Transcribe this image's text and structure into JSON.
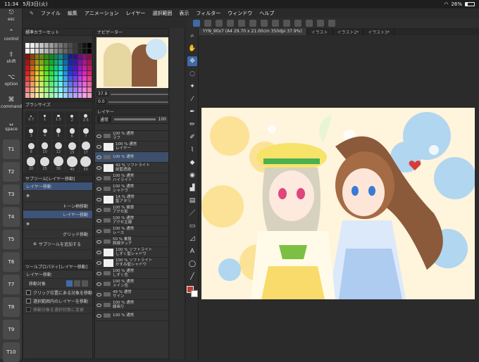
{
  "status_bar": {
    "time": "11:34",
    "date": "5月3日(火)",
    "battery_text": "26%",
    "battery_level": 0.26
  },
  "menubar": [
    "ファイル",
    "編集",
    "アニメーション",
    "レイヤー",
    "選択範囲",
    "表示",
    "フィルター",
    "ウィンドウ",
    "ヘルプ"
  ],
  "left_modifiers": [
    {
      "label": "esc",
      "icon": "esc-icon"
    },
    {
      "label": "control",
      "icon": "control-icon"
    },
    {
      "label": "shift",
      "icon": "shift-icon"
    },
    {
      "label": "option",
      "icon": "option-icon"
    },
    {
      "label": "command",
      "icon": "command-icon"
    },
    {
      "label": "space",
      "icon": "space-icon"
    }
  ],
  "t_keys": [
    "T1",
    "T2",
    "T3",
    "T4",
    "T5",
    "T6",
    "T7",
    "T8",
    "T9",
    "T10"
  ],
  "color_set": {
    "label": "標準カラーセット"
  },
  "brush_size": {
    "title": "ブラシサイズ",
    "values": [
      "0.7",
      "1",
      "1.5",
      "2",
      "2.5",
      "3",
      "4",
      "5",
      "6",
      "7",
      "8",
      "10",
      "12",
      "15",
      "17",
      "20",
      "25",
      "30",
      "40",
      "50"
    ]
  },
  "sub_tool": {
    "title": "サブツール[レイヤー移動]",
    "items": [
      {
        "label": "レイヤー移動",
        "selected": true
      },
      {
        "label": "トーン柄移動",
        "selected": false
      },
      {
        "label": "レイヤー移動",
        "selected": true
      },
      {
        "label": "グリッド移動",
        "selected": false
      }
    ],
    "add_label": "サブツールを追加する"
  },
  "tool_property": {
    "title": "ツールプロパティ[レイヤー移動]",
    "subtitle": "レイヤー移動",
    "target_label": "移動対象",
    "options": [
      {
        "label": "クリック位置にある対象を移動",
        "checked": false
      },
      {
        "label": "選択範囲内のレイヤーを移動",
        "checked": false
      },
      {
        "label": "移動対象を選択状態に変更",
        "checked": false
      }
    ]
  },
  "navigator": {
    "title": "ナビゲーター",
    "zoom": "37.9",
    "angle": "0.0"
  },
  "layer_panel": {
    "title": "レイヤー",
    "blend_mode": "通常",
    "opacity": "100",
    "layers": [
      {
        "opacity": "100 %",
        "mode": "通常",
        "name": "ラフ",
        "type": "folder"
      },
      {
        "opacity": "100 %",
        "mode": "通常",
        "name": "レイヤー",
        "type": "layer"
      },
      {
        "opacity": "100 %",
        "mode": "通常",
        "name": "",
        "type": "folder",
        "selected": true
      },
      {
        "opacity": "42 %",
        "mode": "ソフトライト",
        "name": "前髪透過",
        "type": "layer"
      },
      {
        "opacity": "100 %",
        "mode": "通常",
        "name": "ハイライト",
        "type": "folder"
      },
      {
        "opacity": "100 %",
        "mode": "通常",
        "name": "シャドウ",
        "type": "folder"
      },
      {
        "opacity": "14 %",
        "mode": "通常",
        "name": "髪アタリ",
        "type": "layer"
      },
      {
        "opacity": "100 %",
        "mode": "乗算",
        "name": "アクセ影",
        "type": "folder"
      },
      {
        "opacity": "100 %",
        "mode": "通常",
        "name": "アクセ主線",
        "type": "folder"
      },
      {
        "opacity": "100 %",
        "mode": "通常",
        "name": "レース",
        "type": "folder"
      },
      {
        "opacity": "50 %",
        "mode": "乗算",
        "name": "斜線タッチ",
        "type": "folder"
      },
      {
        "opacity": "100 %",
        "mode": "ソフトライト",
        "name": "しずく髪シャドウ",
        "type": "layer"
      },
      {
        "opacity": "100 %",
        "mode": "ソフトライト",
        "name": "かすみ髪シャドウ",
        "type": "layer"
      },
      {
        "opacity": "100 %",
        "mode": "通常",
        "name": "しずく色",
        "type": "folder"
      },
      {
        "opacity": "100 %",
        "mode": "通常",
        "name": "メイン色",
        "type": "folder"
      },
      {
        "opacity": "49 %",
        "mode": "通常",
        "name": "サイン",
        "type": "folder"
      },
      {
        "opacity": "100 %",
        "mode": "通常",
        "name": "線画り",
        "type": "folder"
      },
      {
        "opacity": "100 %",
        "mode": "通常",
        "name": "",
        "type": "folder"
      }
    ]
  },
  "document_tabs": [
    {
      "label": "YYN_90x7 (A4 29.70 x 21.00cm 350dpi 37.9%)",
      "active": true
    },
    {
      "label": "イラスト",
      "active": false
    },
    {
      "label": "イラスト2*",
      "active": false
    },
    {
      "label": "イラスト3*",
      "active": false
    }
  ],
  "colors": {
    "accent": "#3f6aa7",
    "main_color": "#c0392b",
    "sub_color": "#ffffff"
  }
}
